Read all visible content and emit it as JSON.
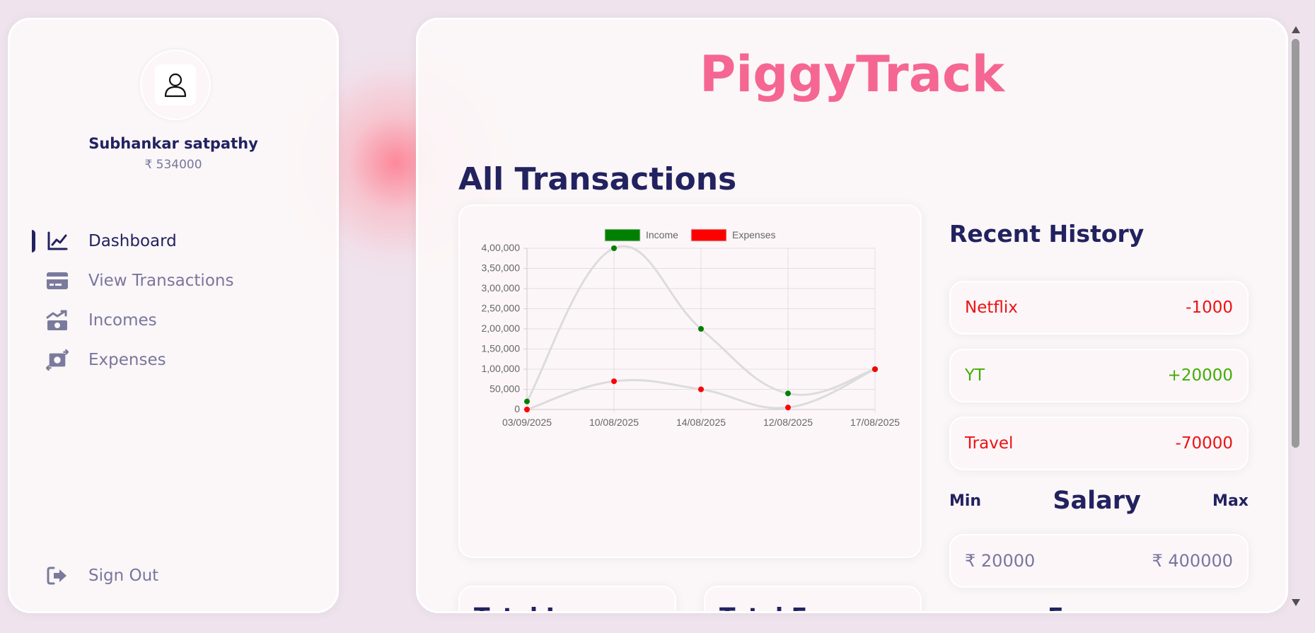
{
  "user": {
    "name": "Subhankar satpathy",
    "balance": "₹ 534000"
  },
  "nav": {
    "items": [
      {
        "label": "Dashboard",
        "icon": "chart-line-icon",
        "active": true
      },
      {
        "label": "View Transactions",
        "icon": "credit-card-icon",
        "active": false
      },
      {
        "label": "Incomes",
        "icon": "money-bill-trend-up-icon",
        "active": false
      },
      {
        "label": "Expenses",
        "icon": "money-bill-transfer-icon",
        "active": false
      }
    ],
    "signout": "Sign Out"
  },
  "app": {
    "title": "PiggyTrack"
  },
  "main": {
    "section_title": "All Transactions",
    "recent_title": "Recent History",
    "history": [
      {
        "title": "Netflix",
        "amount": "-1000",
        "color": "#ee1111"
      },
      {
        "title": "YT",
        "amount": "+20000",
        "color": "#42ad00"
      },
      {
        "title": "Travel",
        "amount": "-70000",
        "color": "#ee1111"
      }
    ],
    "salary": {
      "min_label": "Min",
      "title": "Salary",
      "max_label": "Max",
      "min_value": "₹ 20000",
      "max_value": "₹ 400000"
    },
    "totals": [
      "Total Income",
      "Total Expense"
    ],
    "cut_heading": "Expense"
  },
  "colors": {
    "primary": "#222260",
    "brand": "#f56692",
    "income": "#008000",
    "expense": "#ff0000"
  },
  "chart_data": {
    "type": "line",
    "categories": [
      "03/09/2025",
      "10/08/2025",
      "14/08/2025",
      "12/08/2025",
      "17/08/2025"
    ],
    "series": [
      {
        "name": "Income",
        "values": [
          20000,
          400000,
          200000,
          40000,
          100000
        ],
        "color": "#008000"
      },
      {
        "name": "Expenses",
        "values": [
          0,
          70000,
          50000,
          5000,
          100000
        ],
        "color": "#ff0000"
      }
    ],
    "yticks": [
      "0",
      "50,000",
      "1,00,000",
      "1,50,000",
      "2,00,000",
      "2,50,000",
      "3,00,000",
      "3,50,000",
      "4,00,000"
    ],
    "ylim": [
      0,
      400000
    ],
    "legend": "top",
    "grid": true
  }
}
